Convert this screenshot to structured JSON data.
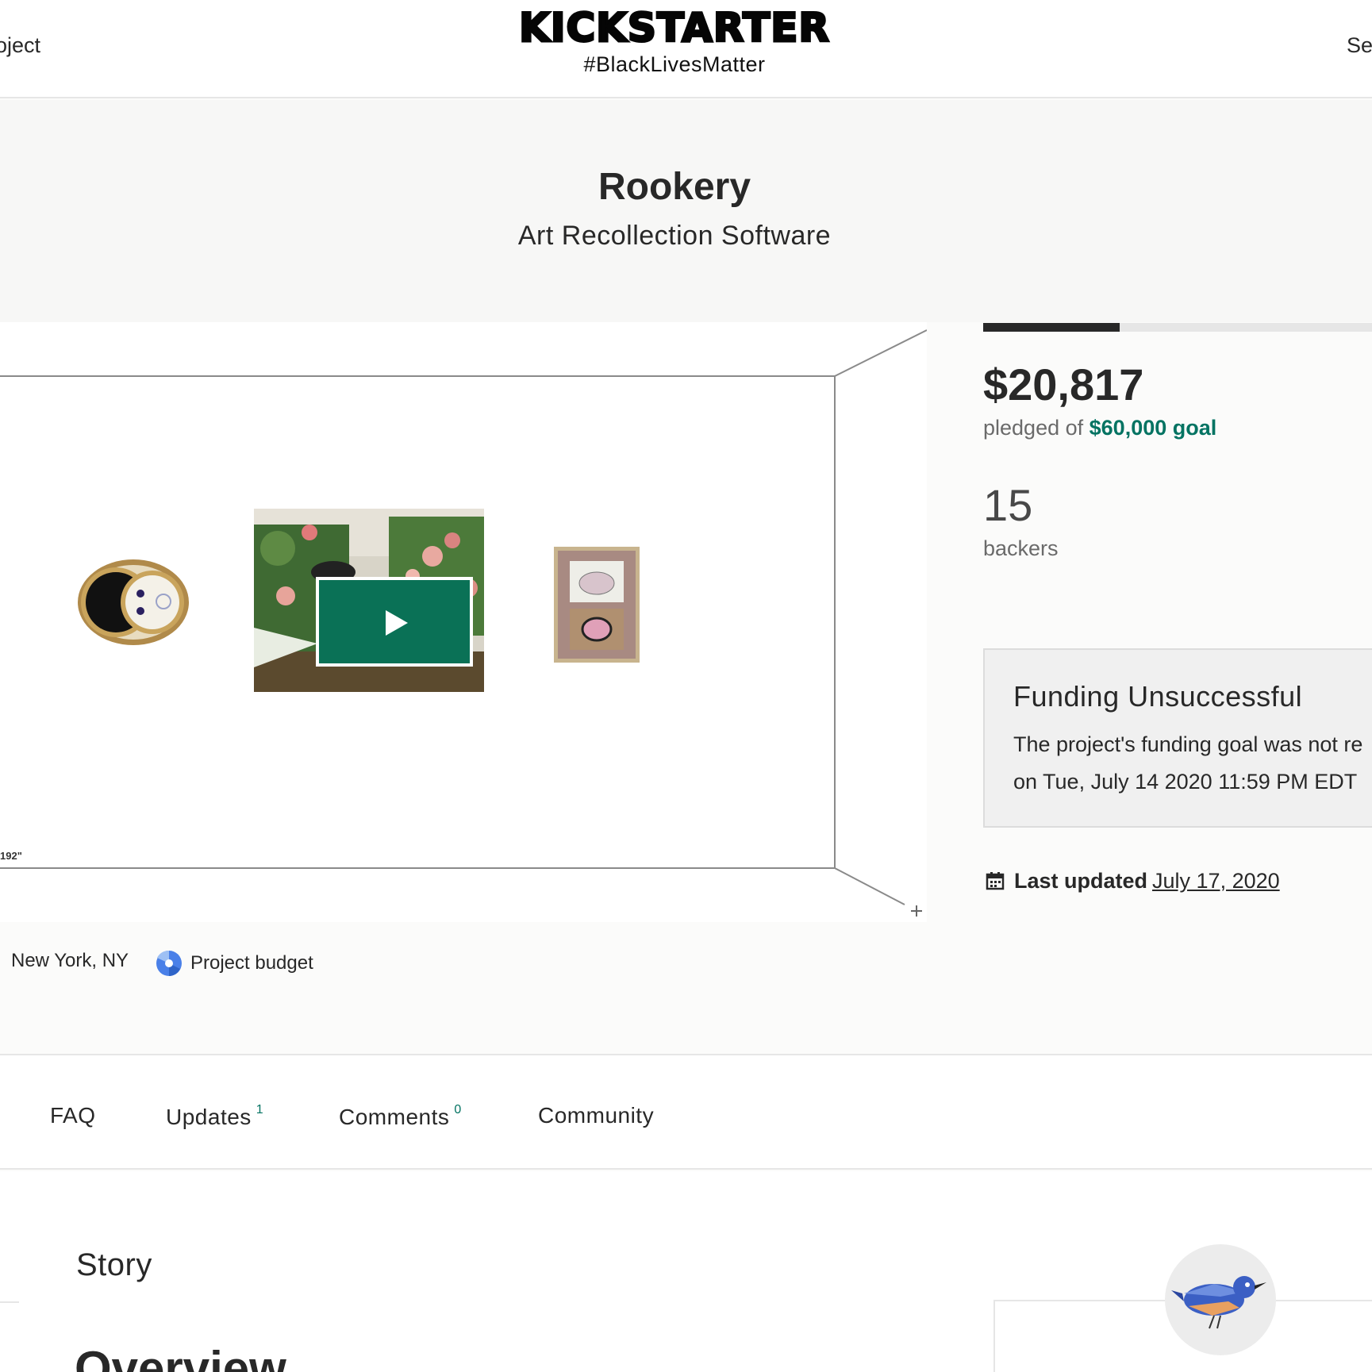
{
  "header": {
    "nav_left": "oject",
    "nav_right": "Se",
    "logo": "KICKSTARTER",
    "hashtag": "#BlackLivesMatter"
  },
  "project": {
    "title": "Rookery",
    "subtitle": "Art Recollection Software"
  },
  "media": {
    "dimension_label": "192\"",
    "play_icon": "play-icon"
  },
  "stats": {
    "progress_fraction": 0.35,
    "pledged": "$20,817",
    "pledged_prefix": "pledged of",
    "goal": "$60,000 goal",
    "backers_count": "15",
    "backers_label": "backers"
  },
  "status": {
    "title": "Funding Unsuccessful",
    "line1": "The project's funding goal was not re",
    "line2": "on Tue, July 14 2020 11:59 PM EDT"
  },
  "updated": {
    "label": "Last updated",
    "date": "July 17, 2020"
  },
  "tags": {
    "location": "New York, NY",
    "budget": "Project budget"
  },
  "tabs": {
    "faq": "FAQ",
    "updates": "Updates",
    "updates_count": "1",
    "comments": "Comments",
    "comments_count": "0",
    "community": "Community"
  },
  "story": {
    "label": "Story",
    "heading": "Overview"
  },
  "colors": {
    "accent": "#037362",
    "play_button": "#0a7156",
    "budget_icon": "#4a80e8"
  }
}
